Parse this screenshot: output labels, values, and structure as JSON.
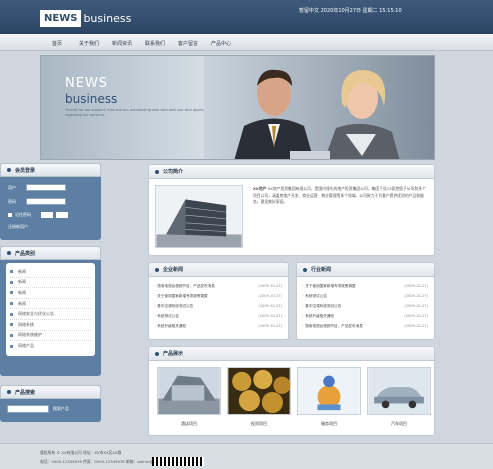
{
  "header": {
    "logo_news": "NEWS",
    "logo_business": "business",
    "top_info": "暂留中文 2020年10月27日 星期二 15:15:10"
  },
  "nav": [
    "首页",
    "关于我们",
    "新闻资讯",
    "联系我们",
    "客户留言",
    "产品中心"
  ],
  "banner": {
    "news": "NEWS",
    "business": "business",
    "text": "Thanks for our support, that and our outstanding web with well you with application, regarding our services."
  },
  "login": {
    "title": "会员登录",
    "user_label": "用户",
    "pass_label": "密码",
    "remember": "记住密码",
    "register": "注册新用户"
  },
  "products_nav": {
    "title": "产品类别",
    "items": [
      "新闻",
      "新闻",
      "新闻",
      "新闻",
      "网络安全与优化公告",
      "网络系统",
      "网络系统维护",
      "网络产品"
    ]
  },
  "search": {
    "title": "产品搜索",
    "button": "搜索产品"
  },
  "intro": {
    "title": "公司简介",
    "lead": "XX地产",
    "text": "XX地产投资集团有限公司，是国内领先的地产投资集团公司，集团下设15家控股子公司和多个项目公司，涵盖房地产开发、商业运营、物业管理等多个领域。公司致力于为客户提供优质的产品和服务，建设美好家园。"
  },
  "news": {
    "title": "企业新闻",
    "items": [
      {
        "t": "· 搜索电视台视频节目，产品发布消息",
        "d": "(2009-10-27)"
      },
      {
        "t": "· 关于使用国家新增专项政策调整",
        "d": "(2009-10-27)"
      },
      {
        "t": "· 集中空调系统测试公告",
        "d": "(2009-10-27)"
      },
      {
        "t": "· 系统测试公告",
        "d": "(2009-10-27)"
      },
      {
        "t": "· 系统升级相关通知",
        "d": "(2009-10-27)"
      }
    ]
  },
  "industry": {
    "title": "行业新闻",
    "items": [
      {
        "t": "· 关于使用国家新增专项政策调整",
        "d": "(2009-10-27)"
      },
      {
        "t": "· 系统测试公告",
        "d": "(2009-10-27)"
      },
      {
        "t": "· 集中空调系统测试公告",
        "d": "(2009-10-27)"
      },
      {
        "t": "· 系统升级相关通知",
        "d": "(2009-10-27)"
      },
      {
        "t": "· 搜索电视台视频节目，产品发布消息",
        "d": "(2009-10-27)"
      }
    ]
  },
  "showcase": {
    "title": "产品展示",
    "items": [
      "酒店项目",
      "投资项目",
      "服务项目",
      "汽车项目"
    ]
  },
  "footer": {
    "line1": "版权所有 © XX有限公司  地址：XX市XX区XX路",
    "line2": "电话：0000-12345678  传真：0000-12345678  邮箱：admin@xxxx.com"
  },
  "colors": {
    "header_bg": "#2b4463",
    "accent": "#5c7fa3",
    "page_bg": "#cfd6dd"
  }
}
